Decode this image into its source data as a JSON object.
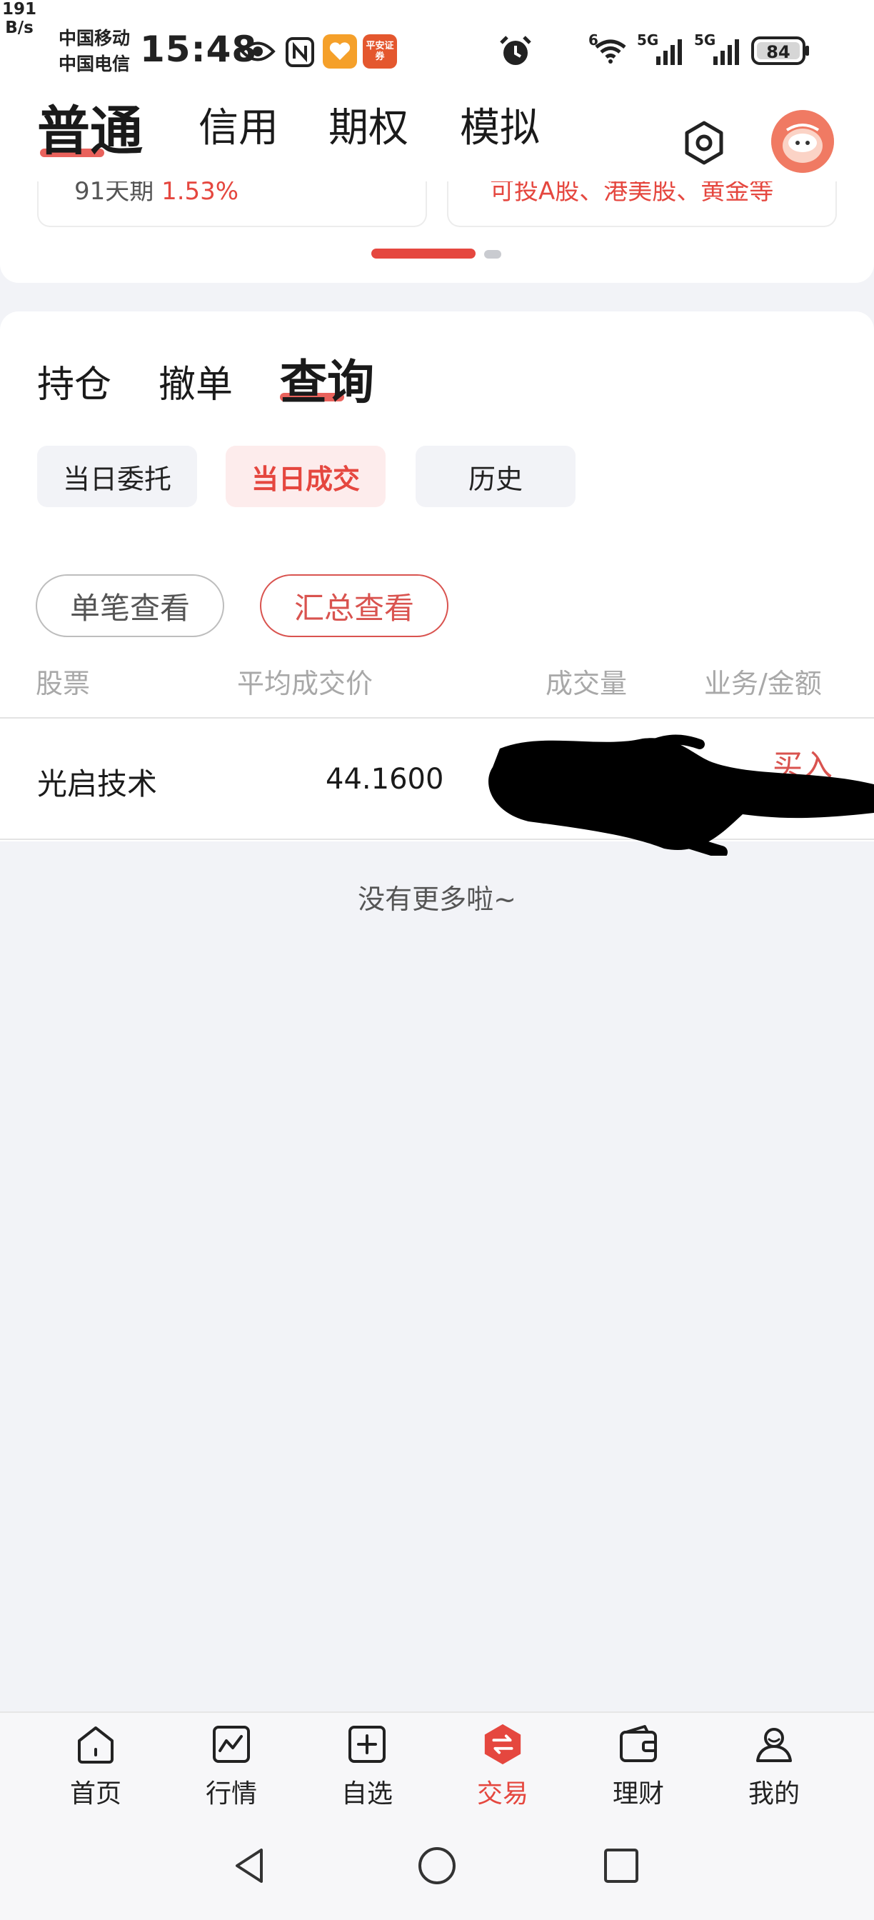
{
  "status_bar": {
    "carrier_1": "中国移动",
    "carrier_2": "中国电信",
    "time": "15:48",
    "pingan_badge": "平安证券",
    "net_speed_value": "191",
    "net_speed_unit": "B/s",
    "wifi_label": "6",
    "signal_1_label": "5G",
    "signal_2_label": "5G",
    "battery": "84",
    "icons": [
      "eye-icon",
      "nfc-icon",
      "health-heart-icon",
      "pingan-app-icon",
      "alarm-icon",
      "wifi-icon",
      "signal-icon",
      "battery-icon"
    ]
  },
  "account_tabs": [
    {
      "label": "普通",
      "active": true
    },
    {
      "label": "信用",
      "active": false
    },
    {
      "label": "期权",
      "active": false
    },
    {
      "label": "模拟",
      "active": false
    }
  ],
  "carousel": {
    "left_card_text": "91天期 ",
    "left_card_highlight": "1.53%",
    "right_card_text": "可投A股、港美股、黄金等",
    "active_index": 0,
    "total": 2
  },
  "sub_tabs": [
    {
      "label": "持仓",
      "active": false
    },
    {
      "label": "撤单",
      "active": false
    },
    {
      "label": "查询",
      "active": true
    }
  ],
  "filters": [
    {
      "label": "当日委托",
      "active": false
    },
    {
      "label": "当日成交",
      "active": true
    },
    {
      "label": "历史",
      "active": false
    }
  ],
  "view_toggle": [
    {
      "label": "单笔查看",
      "active": false
    },
    {
      "label": "汇总查看",
      "active": true
    }
  ],
  "table": {
    "headers": {
      "stock": "股票",
      "avg_price": "平均成交价",
      "volume": "成交量",
      "type_amount": "业务/金额"
    },
    "rows": [
      {
        "stock": "光启技术",
        "avg_price": "44.1600",
        "action": "买入"
      }
    ]
  },
  "no_more_text": "没有更多啦~",
  "bottom_nav": [
    {
      "label": "首页",
      "icon": "home-icon",
      "active": false
    },
    {
      "label": "行情",
      "icon": "chart-icon",
      "active": false
    },
    {
      "label": "自选",
      "icon": "add-icon",
      "active": false
    },
    {
      "label": "交易",
      "icon": "trade-icon",
      "active": true
    },
    {
      "label": "理财",
      "icon": "wallet-icon",
      "active": false
    },
    {
      "label": "我的",
      "icon": "profile-icon",
      "active": false
    }
  ],
  "colors": {
    "accent": "#e5473f",
    "background": "#f2f3f7",
    "muted_text": "#a8a8a8"
  }
}
